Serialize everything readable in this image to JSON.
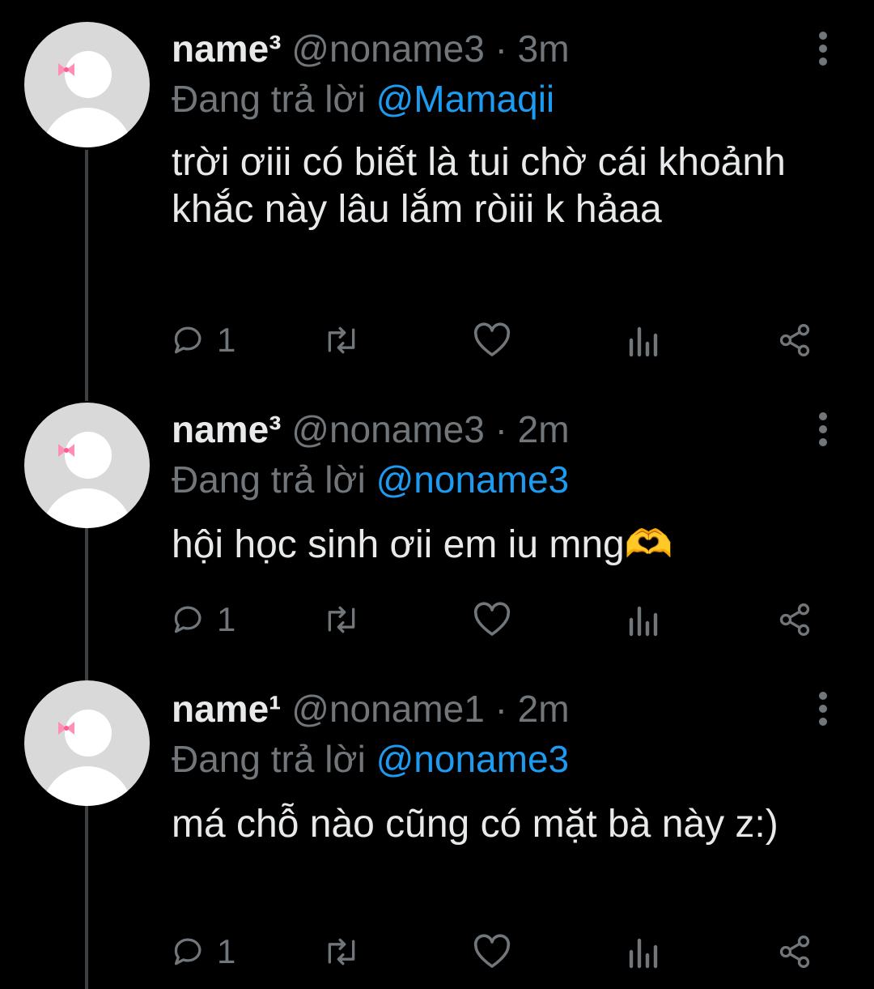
{
  "colors": {
    "background": "#000000",
    "text": "#e7e9ea",
    "muted": "#71767b",
    "accent": "#1d9bf0",
    "avatar": "#d9d9d9",
    "bow": "#ff8fb6"
  },
  "icons": {
    "reply": "reply-icon",
    "retweet": "retweet-icon",
    "like": "heart-icon",
    "views": "views-icon",
    "share": "share-icon",
    "more": "more-icon",
    "avatar": "default-avatar"
  },
  "tweets": [
    {
      "name": "name³",
      "handle": "@noname3",
      "separator": "·",
      "time": "3m",
      "reply_prefix": "Đang trả lời ",
      "reply_to": "@Mamaqii",
      "text": "trời ơiii có biết là tui chờ cái khoảnh khắc này lâu lắm ròiii k hảaa",
      "reply_count": "1"
    },
    {
      "name": "name³",
      "handle": "@noname3",
      "separator": "·",
      "time": "2m",
      "reply_prefix": "Đang trả lời ",
      "reply_to": "@noname3",
      "text": "hội học sinh ơii em iu mng🫶",
      "reply_count": "1"
    },
    {
      "name": "name¹",
      "handle": "@noname1",
      "separator": "·",
      "time": "2m",
      "reply_prefix": "Đang trả lời ",
      "reply_to": "@noname3",
      "text": "má chỗ nào cũng có mặt bà này z:)",
      "reply_count": "1"
    }
  ]
}
